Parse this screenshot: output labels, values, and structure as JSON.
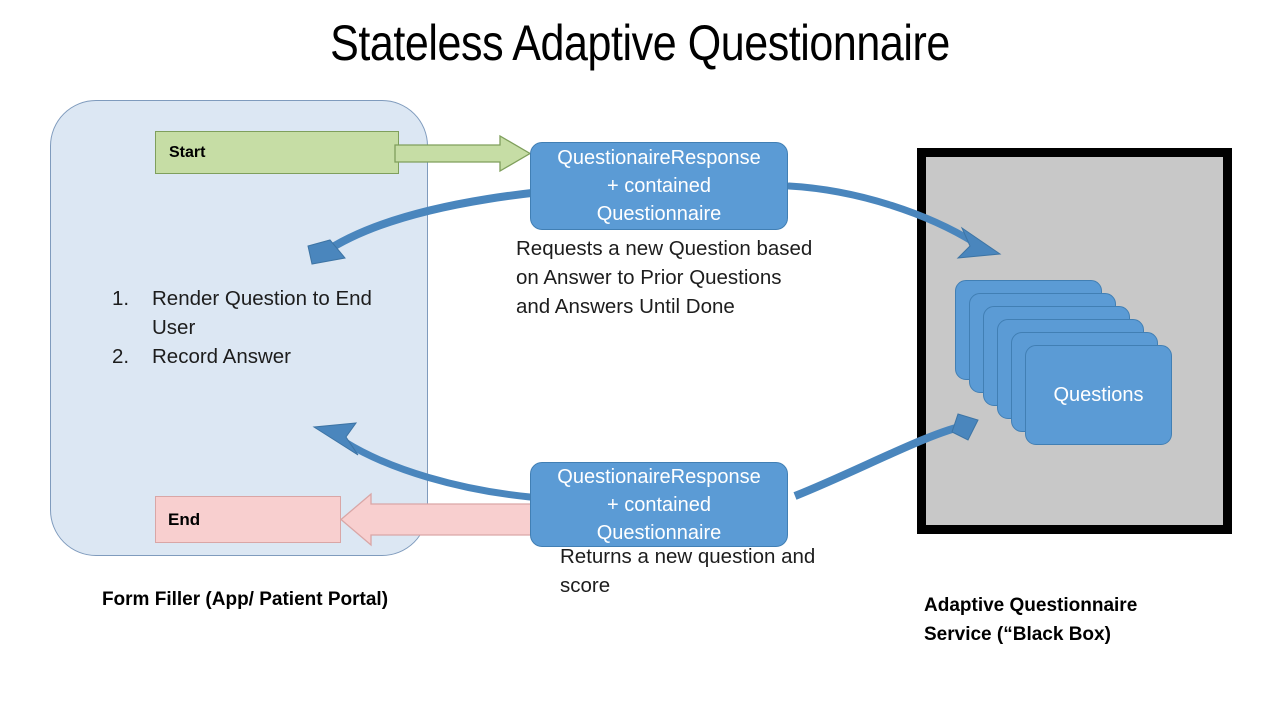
{
  "title": "Stateless Adaptive Questionnaire",
  "form_filler": {
    "caption": "Form Filler (App/ Patient Portal)",
    "start_label": "Start",
    "end_label": "End",
    "steps": [
      {
        "num": "1.",
        "text": "Render Question to End User"
      },
      {
        "num": "2.",
        "text": "Record Answer"
      }
    ]
  },
  "messages": {
    "top": {
      "line1": "QuestionaireResponse",
      "line2": "+ contained",
      "line3": "Questionnaire",
      "caption": "Requests a new Question based on Answer to Prior Questions and Answers Until Done"
    },
    "bottom": {
      "line1": "QuestionaireResponse",
      "line2": "+ contained",
      "line3": "Questionnaire",
      "caption": "Returns a new question and score"
    }
  },
  "service": {
    "caption_line1": "Adaptive Questionnaire",
    "caption_line2": "Service (“Black Box)",
    "stack_label": "Questions"
  },
  "colors": {
    "panel_fill": "#dce7f3",
    "panel_stroke": "#7f9bbd",
    "start_fill": "#c6dda5",
    "start_stroke": "#7f9f5c",
    "end_fill": "#f8cfcf",
    "end_stroke": "#d9a6a6",
    "message_fill": "#5b9bd5",
    "message_stroke": "#417fb4",
    "arrow_blue": "#4a86bd",
    "service_fill": "#c8c8c8",
    "service_stroke": "#000000"
  }
}
